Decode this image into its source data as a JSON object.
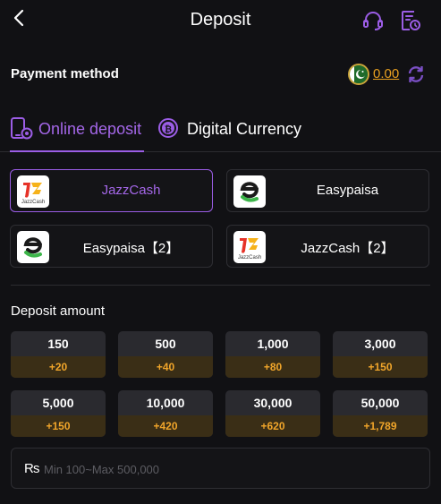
{
  "header": {
    "title": "Deposit",
    "back_icon": "chevron-left-icon",
    "support_icon": "headset-icon",
    "records_icon": "records-icon"
  },
  "payment": {
    "label": "Payment method",
    "balance": "0.00",
    "flag_icon": "pakistan-flag-icon",
    "refresh_icon": "refresh-icon"
  },
  "tabs": [
    {
      "label": "Online deposit",
      "icon": "phone-deposit-icon",
      "active": true
    },
    {
      "label": "Digital Currency",
      "icon": "bitcoin-icon",
      "active": false
    }
  ],
  "methods": [
    {
      "label": "JazzCash",
      "logo": "jazzcash-logo",
      "logo_text": "JazzCash",
      "selected": true
    },
    {
      "label": "Easypaisa",
      "logo": "easypaisa-logo",
      "selected": false
    },
    {
      "label": "Easypaisa【2】",
      "logo": "easypaisa-logo",
      "selected": false
    },
    {
      "label": "JazzCash【2】",
      "logo": "jazzcash-logo",
      "logo_text": "JazzCash",
      "selected": false
    }
  ],
  "deposit": {
    "label": "Deposit amount",
    "amounts": [
      {
        "value": "150",
        "bonus": "+20"
      },
      {
        "value": "500",
        "bonus": "+40"
      },
      {
        "value": "1,000",
        "bonus": "+80"
      },
      {
        "value": "3,000",
        "bonus": "+150"
      },
      {
        "value": "5,000",
        "bonus": "+150"
      },
      {
        "value": "10,000",
        "bonus": "+420"
      },
      {
        "value": "30,000",
        "bonus": "+620"
      },
      {
        "value": "50,000",
        "bonus": "+1,789"
      }
    ],
    "currency": "₨",
    "placeholder": "Min 100~Max 500,000"
  },
  "colors": {
    "accent": "#9b5de5",
    "bonus": "#f0a52a",
    "balance": "#e8a020",
    "background": "#111114"
  }
}
